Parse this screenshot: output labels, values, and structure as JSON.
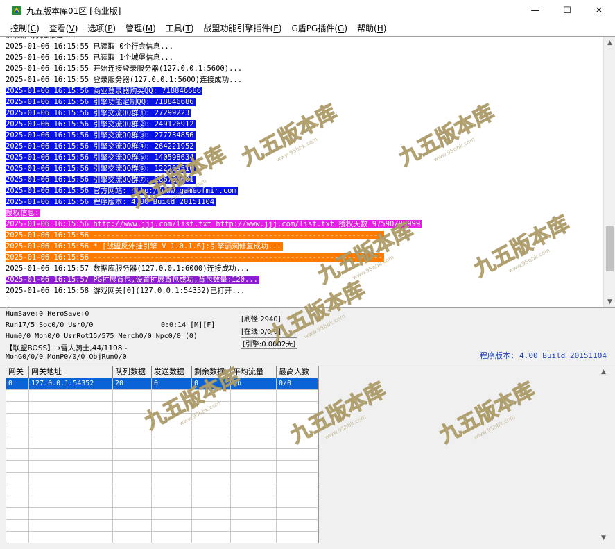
{
  "window": {
    "title": "九五版本库01区 [商业版]",
    "minimize_glyph": "—",
    "maximize_glyph": "☐",
    "close_glyph": "✕"
  },
  "menu": [
    {
      "label": "控制",
      "key": "C"
    },
    {
      "label": "查看",
      "key": "V"
    },
    {
      "label": "选项",
      "key": "P"
    },
    {
      "label": "管理",
      "key": "M"
    },
    {
      "label": "工具",
      "key": "T"
    },
    {
      "label": "战盟功能引擎插件",
      "key": "E"
    },
    {
      "label": "G盾PG插件",
      "key": "G"
    },
    {
      "label": "帮助",
      "key": "H"
    }
  ],
  "log": {
    "lines": [
      {
        "text": "加载游戏状态信息...",
        "style": "plain"
      },
      {
        "text": "2025-01-06 16:15:55 已读取 0个行会信息...",
        "style": "plain"
      },
      {
        "text": "2025-01-06 16:15:55 已读取 1个城堡信息...",
        "style": "plain"
      },
      {
        "text": "2025-01-06 16:15:55 开始连接登录服务器(127.0.0.1:5600)...",
        "style": "plain"
      },
      {
        "text": "2025-01-06 16:15:55 登录服务器(127.0.0.1:5600)连接成功...",
        "style": "plain"
      },
      {
        "text": "2025-01-06 16:15:56 商业登录器购买QQ: 718846686",
        "style": "blue"
      },
      {
        "text": "2025-01-06 16:15:56 引擎功能定制QQ: 718846686",
        "style": "blue"
      },
      {
        "text": "2025-01-06 16:15:56 引擎交流QQ群①: 27299223",
        "style": "blue"
      },
      {
        "text": "2025-01-06 16:15:56 引擎交流QQ群②: 249126912",
        "style": "blue"
      },
      {
        "text": "2025-01-06 16:15:56 引擎交流QQ群③: 277734856",
        "style": "blue"
      },
      {
        "text": "2025-01-06 16:15:56 引擎交流QQ群④: 264221952",
        "style": "blue"
      },
      {
        "text": "2025-01-06 16:15:56 引擎交流QQ群⑤: 140598634",
        "style": "blue"
      },
      {
        "text": "2025-01-06 16:15:56 引擎交流QQ群⑥: 122209510",
        "style": "blue"
      },
      {
        "text": "2025-01-06 16:15:56 引擎交流QQ群⑦: 286703001",
        "style": "blue"
      },
      {
        "text": "2025-01-06 16:15:56 官方网站: http://www.gameofmir.com",
        "style": "blue"
      },
      {
        "text": "2025-01-06 16:15:56 程序版本: 4.00 Build 20151104",
        "style": "blue"
      },
      {
        "text": "授权信息:",
        "style": "magenta"
      },
      {
        "text": "2025-01-06 16:15:56 http://www.jjj.com/list.txt http://www.jjj.com/list.txt 授权天数 97590/99999",
        "style": "magenta"
      },
      {
        "text": "2025-01-06 16:15:56 ------------------------------------------------------------------",
        "style": "orange"
      },
      {
        "text": "2025-01-06 16:15:56 * [战盟反外挂引擎 V 1.0.1.6]:引擎漏洞修复成功...",
        "style": "orange"
      },
      {
        "text": "2025-01-06 16:15:56 ------------------------------------------------------------------",
        "style": "orange"
      },
      {
        "text": "2025-01-06 16:15:57 数据库服务器(127.0.0.1:6000)连接成功...",
        "style": "plain"
      },
      {
        "text": "2025-01-06 16:15:57 PG扩展背包,设置扩展背包成功,背包数量:120...",
        "style": "purple"
      },
      {
        "text": "2025-01-06 16:15:58 游戏网关[0](127.0.0.1:54352)已打开...",
        "style": "plain"
      }
    ]
  },
  "status": {
    "line1": "HumSave:0 HeroSave:0",
    "line2": "Run17/5 Soc0/0 Usr0/0",
    "timer": "0:0:14 [M][F]",
    "line3": "Hum0/0 Mon0/0 UsrRot15/575 Merch0/0 Npc0/0 (0)",
    "line4": "【联盟BOSS】→雪人骑士,44/1108 -",
    "line5": "MonG0/0/0 MonP0/0/0 ObjRun0/0",
    "refresh_monsters": "[刷怪:2940]",
    "online": "[在线:0/0/0]",
    "engine": "[引擎:0.0002天]",
    "version": "程序版本: 4.00 Build 20151104"
  },
  "gate_table": {
    "columns": [
      "网关",
      "网关地址",
      "队列数据",
      "发送数据",
      "剩余数据",
      "平均流量",
      "最高人数"
    ],
    "rows": [
      [
        "0",
        "127.0.0.1:54352",
        "20",
        "0",
        "0",
        "0b",
        "0/0"
      ]
    ]
  },
  "watermark": {
    "text": "九五版本库",
    "sub": "www.95bbk.com"
  },
  "colors": {
    "blue_highlight": "#0a14e6",
    "magenta_highlight": "#e51ee5",
    "orange_highlight": "#ff7a00",
    "purple_highlight": "#8b1fd1",
    "selection": "#0a64d8",
    "version_text": "#1a3fb8"
  }
}
